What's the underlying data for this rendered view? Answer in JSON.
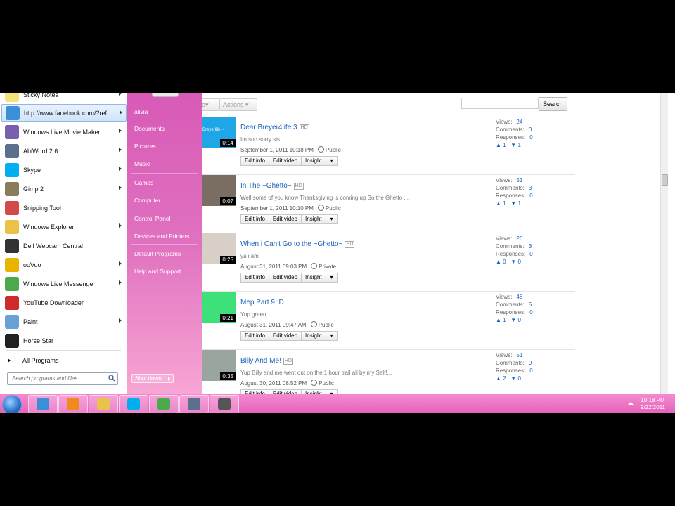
{
  "youtube": {
    "toolbar": {
      "actions_label": "Actions",
      "search_button": "Search",
      "partial_label": "o"
    },
    "buttons": {
      "edit_info": "Edit info",
      "edit_video": "Edit video",
      "insight": "Insight"
    },
    "stat_labels": {
      "views": "Views:",
      "comments": "Comments:",
      "responses": "Responses:"
    },
    "hd_badge": "HD",
    "videos": [
      {
        "title": "Dear Breyer4life 3",
        "hd": true,
        "duration": "0:14",
        "description": "Im soo sorry sis",
        "date": "September 1, 2011 10:18 PM",
        "privacy": "Public",
        "views": "24",
        "comments": "0",
        "responses": "0",
        "likes": "1",
        "dislikes": "1",
        "thumb_color": "#1fa6e6",
        "thumb_caption": "Breyerlife ~"
      },
      {
        "title": "In The ~Ghetto~",
        "hd": true,
        "duration": "0:07",
        "description": "Well some of you know Thanksgiving is coming up So the Ghetto ...",
        "date": "September 1, 2011 10:10 PM",
        "privacy": "Public",
        "views": "51",
        "comments": "3",
        "responses": "0",
        "likes": "1",
        "dislikes": "1",
        "thumb_color": "#7a6d62"
      },
      {
        "title": "When i Can't Go to the ~Ghetto~",
        "hd": true,
        "duration": "0:25",
        "description": "ya i am",
        "date": "August 31, 2011 09:03 PM",
        "privacy": "Private",
        "views": "26",
        "comments": "3",
        "responses": "0",
        "likes": "0",
        "dislikes": "0",
        "thumb_color": "#d8cfc6"
      },
      {
        "title": "Mep Part 9 :D",
        "hd": false,
        "duration": "0:21",
        "description": "Yup green",
        "date": "August 31, 2011 09:47 AM",
        "privacy": "Public",
        "views": "48",
        "comments": "5",
        "responses": "0",
        "likes": "1",
        "dislikes": "0",
        "thumb_color": "#3ee07a"
      },
      {
        "title": "Billy And Me!",
        "hd": true,
        "duration": "0:35",
        "description": "Yup Billy and me went out on the 1 hour trail all by my Self!...",
        "date": "August 30, 2011 08:52 PM",
        "privacy": "Public",
        "views": "51",
        "comments": "9",
        "responses": "0",
        "likes": "2",
        "dislikes": "0",
        "thumb_color": "#9aa5a0"
      }
    ]
  },
  "start_menu": {
    "programs": [
      {
        "label": "Sticky Notes",
        "icon": "sticky-notes-icon",
        "color": "#f3e27a",
        "arrow": true
      },
      {
        "label": "http://www.facebook.com/?ref...",
        "icon": "internet-explorer-icon",
        "color": "#3a8fd8",
        "arrow": true,
        "highlighted": true
      },
      {
        "label": "Windows Live Movie Maker",
        "icon": "movie-maker-icon",
        "color": "#7a5fb0",
        "arrow": true
      },
      {
        "label": "AbiWord 2.6",
        "icon": "abiword-icon",
        "color": "#5c6f8c",
        "arrow": true
      },
      {
        "label": "Skype",
        "icon": "skype-icon",
        "color": "#00aff0",
        "arrow": true
      },
      {
        "label": "Gimp 2",
        "icon": "gimp-icon",
        "color": "#8a7a5e",
        "arrow": true
      },
      {
        "label": "Snipping Tool",
        "icon": "scissors-icon",
        "color": "#d24a4a",
        "arrow": false
      },
      {
        "label": "Windows Explorer",
        "icon": "folder-icon",
        "color": "#e9c24a",
        "arrow": true
      },
      {
        "label": "Dell Webcam Central",
        "icon": "webcam-icon",
        "color": "#333333",
        "arrow": false
      },
      {
        "label": "ooVoo",
        "icon": "oovoo-icon",
        "color": "#e8b400",
        "arrow": true
      },
      {
        "label": "Windows Live Messenger",
        "icon": "messenger-icon",
        "color": "#4caa4c",
        "arrow": true
      },
      {
        "label": "YouTube Downloader",
        "icon": "youtube-downloader-icon",
        "color": "#d12a2a",
        "arrow": false
      },
      {
        "label": "Paint",
        "icon": "paint-icon",
        "color": "#6aa0d8",
        "arrow": true
      },
      {
        "label": "Horse Star",
        "icon": "horse-icon",
        "color": "#222222",
        "arrow": false
      }
    ],
    "all_programs": "All Programs",
    "search_placeholder": "Search programs and files",
    "right_items": [
      {
        "label": "alivia"
      },
      {
        "label": "Documents"
      },
      {
        "label": "Pictures"
      },
      {
        "label": "Music"
      },
      {
        "label": "Games"
      },
      {
        "label": "Computer"
      },
      {
        "label": "Control Panel"
      },
      {
        "label": "Devices and Printers"
      },
      {
        "label": "Default Programs"
      },
      {
        "label": "Help and Support"
      }
    ],
    "shutdown_label": "Shut down"
  },
  "taskbar": {
    "pinned": [
      {
        "icon": "internet-explorer-icon",
        "color": "#3a8fd8"
      },
      {
        "icon": "media-player-icon",
        "color": "#f08a1e"
      },
      {
        "icon": "folder-icon",
        "color": "#e9c24a"
      },
      {
        "icon": "skype-icon",
        "color": "#00aff0"
      },
      {
        "icon": "messenger-icon",
        "color": "#4caa4c"
      },
      {
        "icon": "abiword-icon",
        "color": "#5c6f8c"
      },
      {
        "icon": "horse-star-icon",
        "color": "#555555"
      }
    ],
    "time": "10:18 PM",
    "date": "9/22/2011"
  }
}
